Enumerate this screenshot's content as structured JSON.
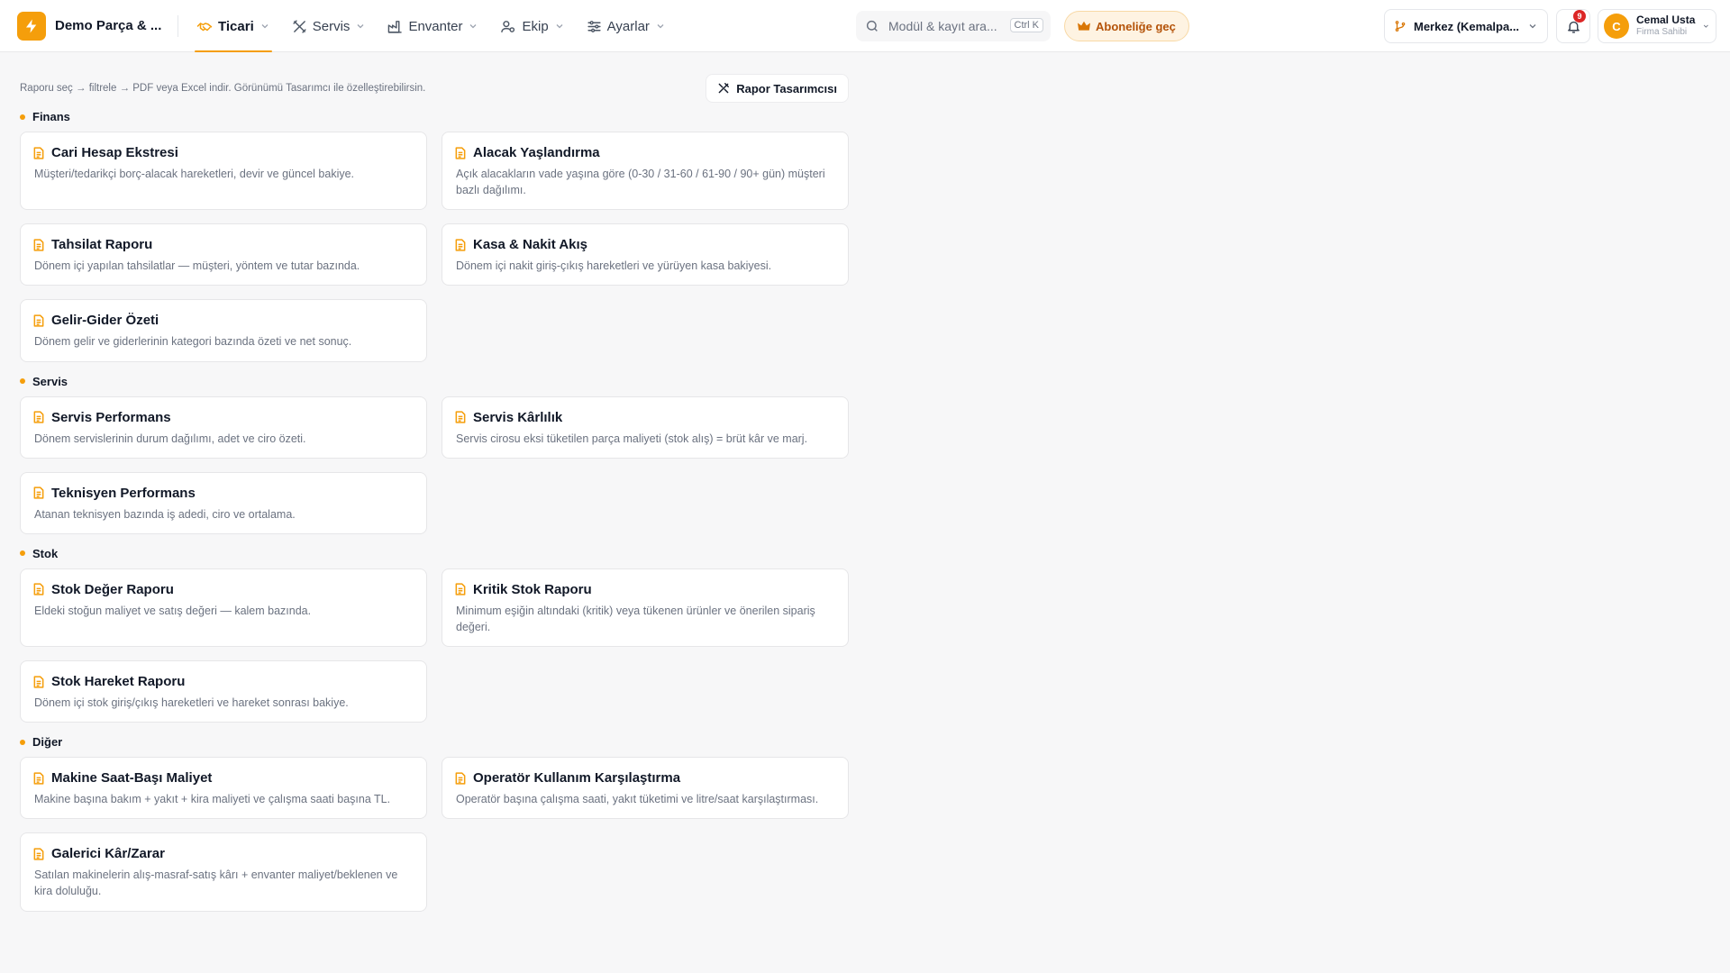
{
  "header": {
    "company": "Demo Parça & ...",
    "nav": [
      {
        "label": "Ticari",
        "active": true
      },
      {
        "label": "Servis"
      },
      {
        "label": "Envanter"
      },
      {
        "label": "Ekip"
      },
      {
        "label": "Ayarlar"
      }
    ],
    "search": {
      "placeholder": "Modül & kayıt ara...",
      "shortcut": "Ctrl K"
    },
    "subscribe": "Aboneliğe geç",
    "branch": "Merkez (Kemalpa...",
    "notifications": "9",
    "user": {
      "initial": "C",
      "name": "Cemal Usta",
      "role": "Firma Sahibi"
    }
  },
  "toolbar": {
    "hint": "Raporu seç → filtrele → PDF veya Excel indir. Görünümü Tasarımcı ile özelleştirebilirsin.",
    "designer": "Rapor Tasarımcısı"
  },
  "sections": [
    {
      "title": "Finans",
      "reports": [
        {
          "title": "Cari Hesap Ekstresi",
          "desc": "Müşteri/tedarikçi borç-alacak hareketleri, devir ve güncel bakiye."
        },
        {
          "title": "Alacak Yaşlandırma",
          "desc": "Açık alacakların vade yaşına göre (0-30 / 31-60 / 61-90 / 90+ gün) müşteri bazlı dağılımı."
        },
        {
          "title": "Tahsilat Raporu",
          "desc": "Dönem içi yapılan tahsilatlar — müşteri, yöntem ve tutar bazında."
        },
        {
          "title": "Kasa & Nakit Akış",
          "desc": "Dönem içi nakit giriş-çıkış hareketleri ve yürüyen kasa bakiyesi."
        },
        {
          "title": "Gelir-Gider Özeti",
          "desc": "Dönem gelir ve giderlerinin kategori bazında özeti ve net sonuç."
        }
      ]
    },
    {
      "title": "Servis",
      "reports": [
        {
          "title": "Servis Performans",
          "desc": "Dönem servislerinin durum dağılımı, adet ve ciro özeti."
        },
        {
          "title": "Servis Kârlılık",
          "desc": "Servis cirosu eksi tüketilen parça maliyeti (stok alış) = brüt kâr ve marj."
        },
        {
          "title": "Teknisyen Performans",
          "desc": "Atanan teknisyen bazında iş adedi, ciro ve ortalama."
        }
      ]
    },
    {
      "title": "Stok",
      "reports": [
        {
          "title": "Stok Değer Raporu",
          "desc": "Eldeki stoğun maliyet ve satış değeri — kalem bazında."
        },
        {
          "title": "Kritik Stok Raporu",
          "desc": "Minimum eşiğin altındaki (kritik) veya tükenen ürünler ve önerilen sipariş değeri."
        },
        {
          "title": "Stok Hareket Raporu",
          "desc": "Dönem içi stok giriş/çıkış hareketleri ve hareket sonrası bakiye."
        }
      ]
    },
    {
      "title": "Diğer",
      "reports": [
        {
          "title": "Makine Saat-Başı Maliyet",
          "desc": "Makine başına bakım + yakıt + kira maliyeti ve çalışma saati başına TL."
        },
        {
          "title": "Operatör Kullanım Karşılaştırma",
          "desc": "Operatör başına çalışma saati, yakıt tüketimi ve litre/saat karşılaştırması."
        },
        {
          "title": "Galerici Kâr/Zarar",
          "desc": "Satılan makinelerin alış-masraf-satış kârı + envanter maliyet/beklenen ve kira doluluğu."
        }
      ]
    }
  ],
  "colors": {
    "accent": "#f59e0b",
    "accent_text": "#b45309"
  }
}
